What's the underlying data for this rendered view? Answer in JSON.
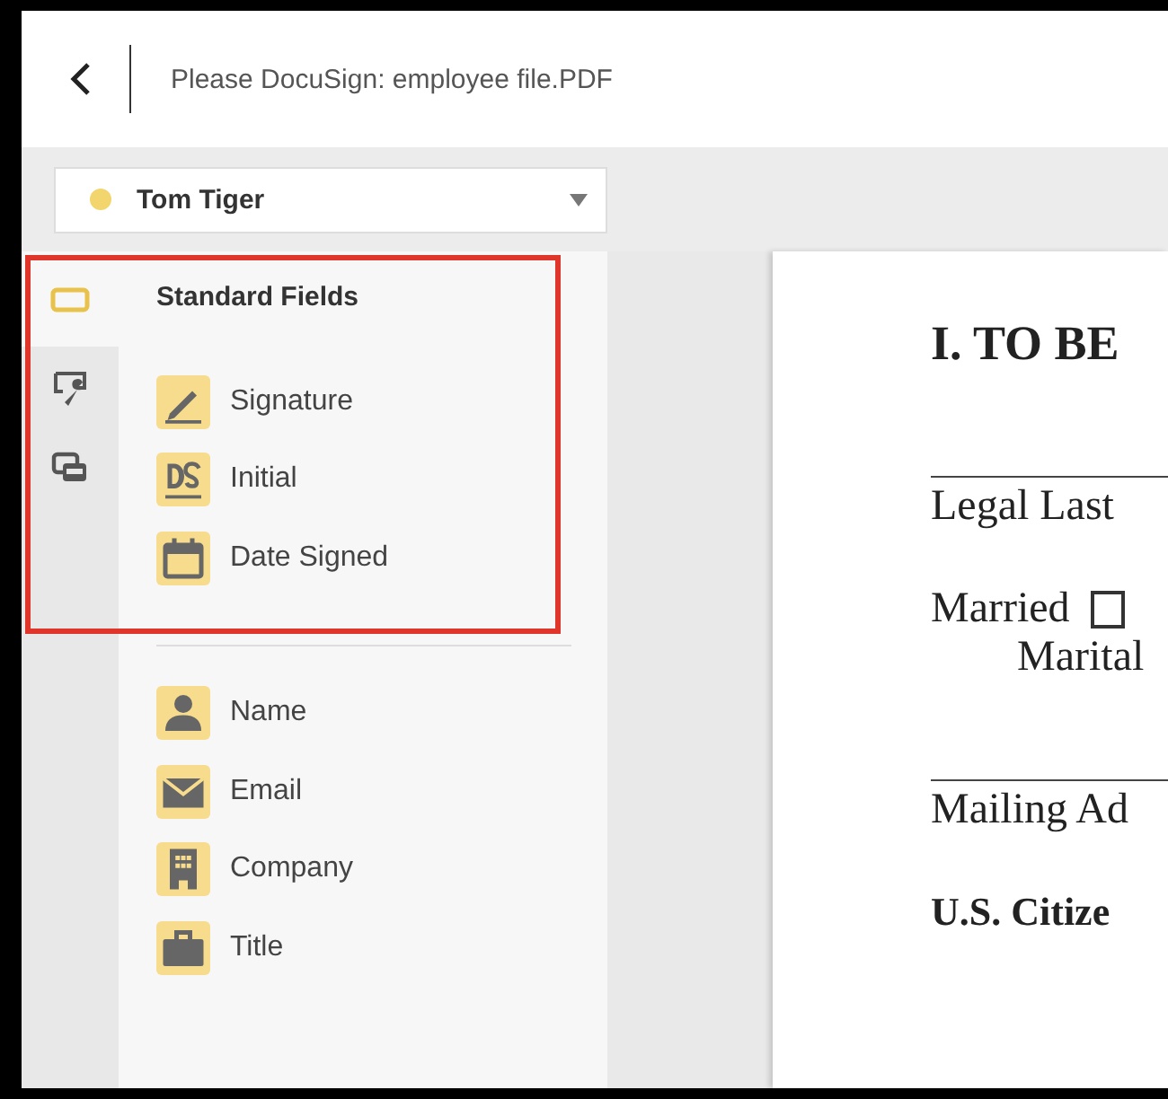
{
  "header": {
    "title": "Please DocuSign: employee file.PDF"
  },
  "recipient": {
    "name": "Tom Tiger",
    "color": "#f3d56e"
  },
  "rail_tabs": [
    {
      "kind": "fields",
      "selected": true
    },
    {
      "kind": "tools",
      "selected": false
    },
    {
      "kind": "chat",
      "selected": false
    }
  ],
  "field_groups": [
    {
      "title": "Standard Fields",
      "items": [
        {
          "kind": "signature",
          "label": "Signature"
        },
        {
          "kind": "initial",
          "label": "Initial"
        },
        {
          "kind": "date",
          "label": "Date Signed"
        }
      ]
    },
    {
      "items": [
        {
          "kind": "name",
          "label": "Name"
        },
        {
          "kind": "email",
          "label": "Email"
        },
        {
          "kind": "company",
          "label": "Company"
        },
        {
          "kind": "title",
          "label": "Title"
        }
      ]
    }
  ],
  "document": {
    "lines": [
      {
        "kind": "heading",
        "text": "I. TO BE"
      },
      {
        "kind": "rule"
      },
      {
        "kind": "text",
        "text": "Legal Last"
      },
      {
        "kind": "checkbox",
        "text": "Married",
        "checked": false
      },
      {
        "kind": "indent",
        "text": "Marital"
      },
      {
        "kind": "rule"
      },
      {
        "kind": "text",
        "text": "Mailing Ad"
      },
      {
        "kind": "bold",
        "text": "U.S. Citize"
      }
    ]
  }
}
